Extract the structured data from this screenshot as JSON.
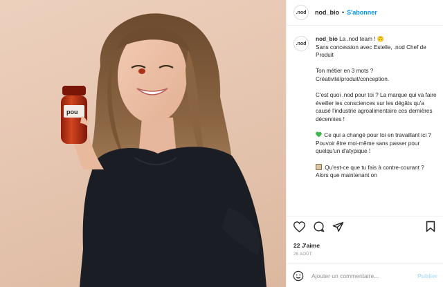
{
  "post": {
    "username": "nod_bio",
    "follow_label": "S'abonner",
    "separator": "•",
    "avatar_text": ".nod",
    "jar_label": "pou",
    "caption": {
      "line1": "La .nod team ! 🙃",
      "line2": "Sans concession avec Estelle, .nod Chef de Produit",
      "p2a": "Ton métier en 3 mots ?",
      "p2b": "Créativité/produit/conception.",
      "p3": "C'est quoi .nod pour toi ? La marque qui va faire éveiller les consciences sur les dégâts qu'a causé l'industrie agroalimentaire ces dernières décennies !",
      "p4": "Ce qui a changé pour toi en travaillant ici ? Pouvoir être moi-même sans passer pour quelqu'un d'atypique !",
      "p5": "Qu'est-ce que tu fais à contre-courant ? Alors que maintenant on"
    },
    "likes": "22 J'aime",
    "date": "28 AOÛT",
    "comment": {
      "placeholder": "Ajouter un commentaire...",
      "publish_label": "Publier"
    },
    "icons": {
      "like": "heart-icon",
      "comment": "comment-icon",
      "share": "share-icon",
      "save": "bookmark-icon",
      "emoji": "emoji-icon"
    },
    "colors": {
      "link_blue": "#0095f6",
      "publish_disabled": "#b2dffc",
      "jar_red": "#c23a1c"
    }
  }
}
